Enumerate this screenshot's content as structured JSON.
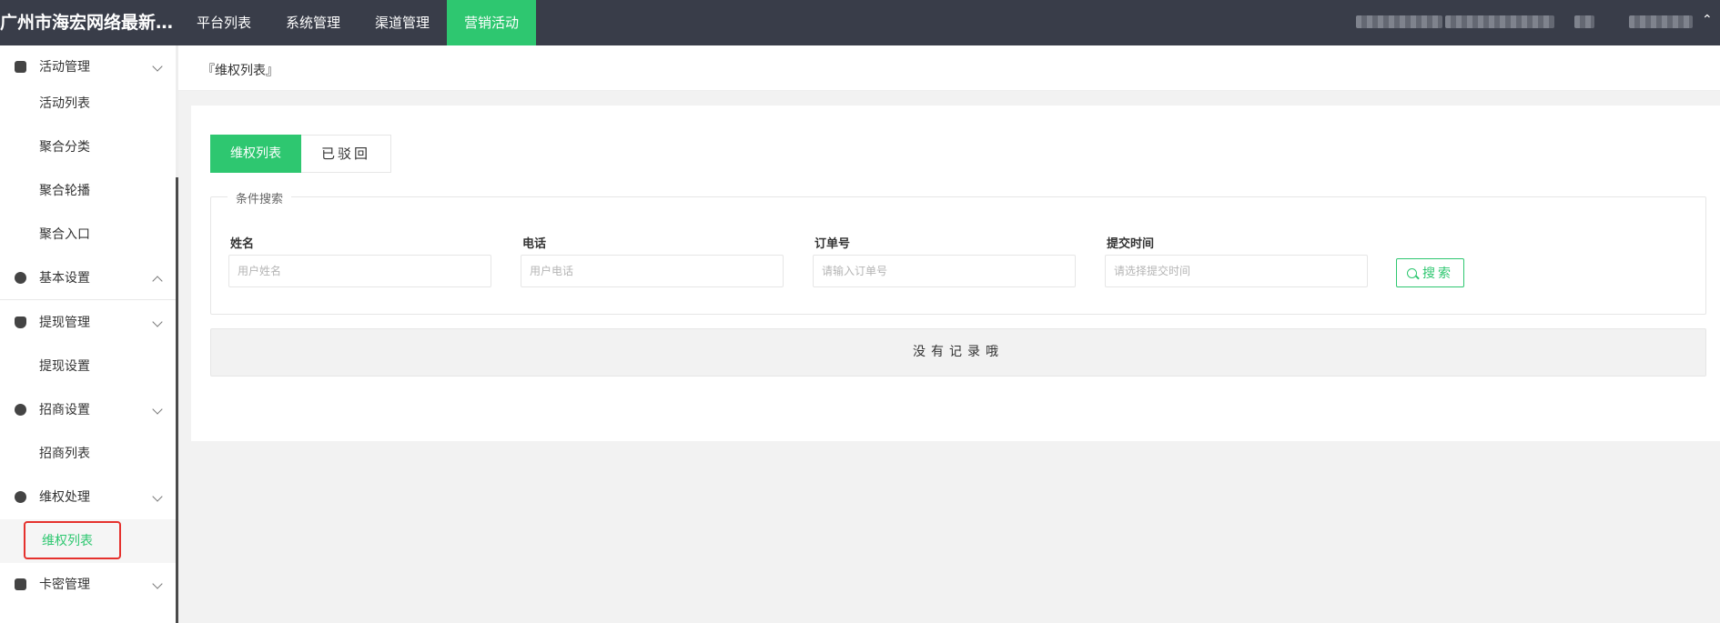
{
  "app": {
    "title": "广州市海宏网络最新红包系统"
  },
  "topnav": {
    "items": [
      {
        "label": "平台列表"
      },
      {
        "label": "系统管理"
      },
      {
        "label": "渠道管理"
      },
      {
        "label": "营销活动"
      }
    ],
    "active_index": 3
  },
  "sidebar": {
    "activity": {
      "label": "活动管理",
      "icon": "lock-icon"
    },
    "activity_list": {
      "label": "活动列表"
    },
    "agg_category": {
      "label": "聚合分类"
    },
    "agg_carousel": {
      "label": "聚合轮播"
    },
    "agg_entry": {
      "label": "聚合入口"
    },
    "basic": {
      "label": "基本设置",
      "icon": "link-icon"
    },
    "withdraw": {
      "label": "提现管理",
      "icon": "money-bag-icon"
    },
    "withdraw_settings": {
      "label": "提现设置"
    },
    "invest": {
      "label": "招商设置",
      "icon": "compass-icon"
    },
    "invest_list": {
      "label": "招商列表"
    },
    "rights": {
      "label": "维权处理",
      "icon": "user-circle-icon"
    },
    "rights_list": {
      "label": "维权列表"
    },
    "card": {
      "label": "卡密管理",
      "icon": "card-icon"
    }
  },
  "page": {
    "breadcrumb": "『维权列表』"
  },
  "tabs": {
    "list": {
      "label": "维权列表"
    },
    "rejected": {
      "label": "已驳回"
    }
  },
  "search": {
    "legend": "条件搜索",
    "name_label": "姓名",
    "name_placeholder": "用户姓名",
    "phone_label": "电话",
    "phone_placeholder": "用户电话",
    "order_label": "订单号",
    "order_placeholder": "请输入订单号",
    "time_label": "提交时间",
    "time_placeholder": "请选择提交时间",
    "button_label": "搜索"
  },
  "table": {
    "empty_text": "没有记录哦"
  },
  "colors": {
    "accent": "#2ec770",
    "topbar": "#393d49",
    "highlight": "#e5312d"
  }
}
